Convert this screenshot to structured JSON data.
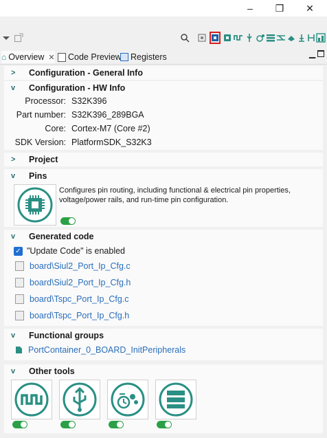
{
  "window": {
    "minimize_glyph": "–",
    "restore_glyph": "❐",
    "close_glyph": "✕"
  },
  "tabs": [
    {
      "label": "Overview",
      "icon": "home-icon"
    },
    {
      "label": "Code Preview",
      "icon": "code-icon"
    },
    {
      "label": "Registers",
      "icon": "registers-icon"
    }
  ],
  "sections": {
    "general": {
      "title": "Configuration - General Info",
      "expanded": false
    },
    "hw": {
      "title": "Configuration - HW Info",
      "expanded": true,
      "rows": [
        {
          "label": "Processor:",
          "value": "S32K396"
        },
        {
          "label": "Part number:",
          "value": "S32K396_289BGA"
        },
        {
          "label": "Core:",
          "value": "Cortex-M7 (Core #2)"
        },
        {
          "label": "SDK Version:",
          "value": "PlatformSDK_S32K3"
        }
      ]
    },
    "project": {
      "title": "Project",
      "expanded": false
    },
    "pins": {
      "title": "Pins",
      "description_line1": "Configures pin routing, including functional & electrical pin properties,",
      "description_line2": "voltage/power rails, and run-time pin configuration.",
      "enabled": true
    },
    "generated": {
      "title": "Generated code",
      "update_code": "\"Update Code\" is enabled",
      "files": [
        "board\\Siul2_Port_Ip_Cfg.c",
        "board\\Siul2_Port_Ip_Cfg.h",
        "board\\Tspc_Port_Ip_Cfg.c",
        "board\\Tspc_Port_Ip_Cfg.h"
      ]
    },
    "functional": {
      "title": "Functional groups",
      "group": "PortContainer_0_BOARD_InitPeripherals"
    },
    "other": {
      "title": "Other tools",
      "tools": [
        "peripherals-tool-icon",
        "usb-tool-icon",
        "clocks-tool-icon",
        "registers-tool-icon"
      ]
    }
  },
  "colors": {
    "accent": "#2a8f84",
    "link": "#2a6ebb",
    "toggle_on": "#2aa146"
  }
}
